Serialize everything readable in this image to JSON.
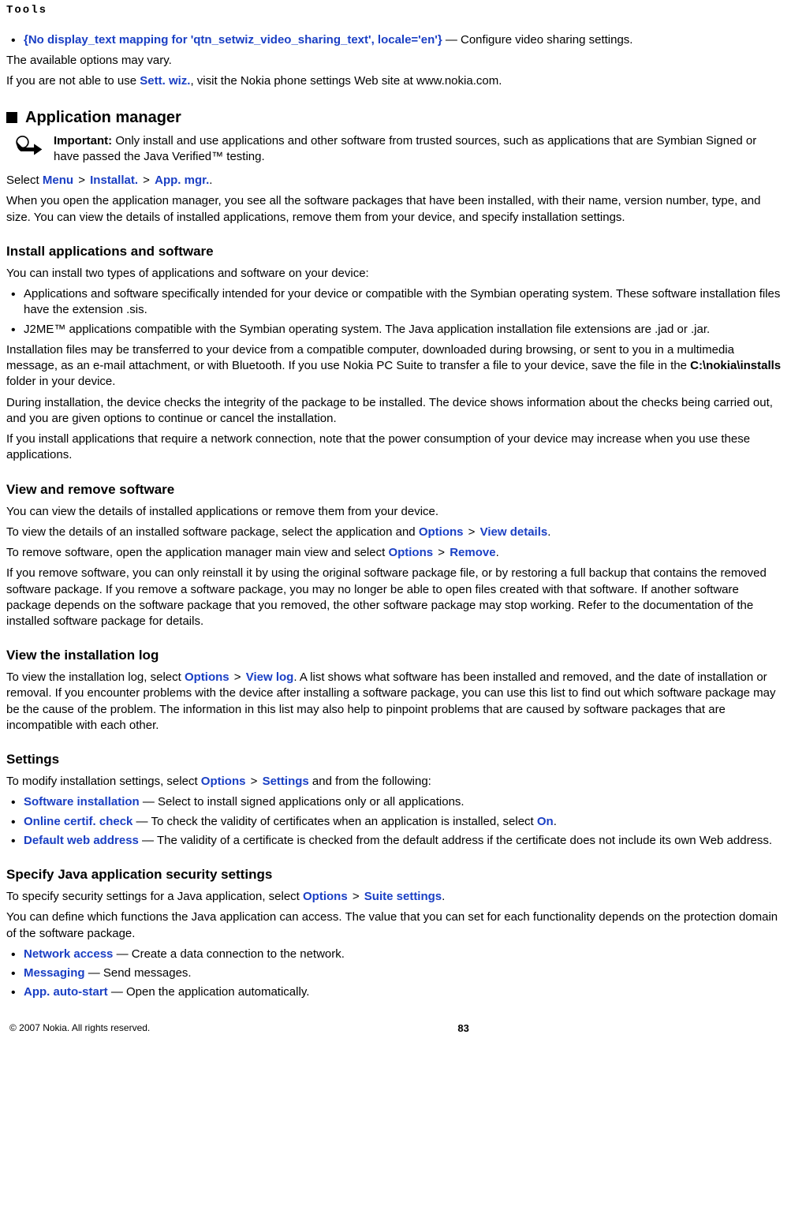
{
  "header": "Tools",
  "intro": {
    "bullet_link": "{No display_text mapping for 'qtn_setwiz_video_sharing_text', locale='en'}",
    "bullet_rest": " — Configure video sharing settings.",
    "p1": "The available options may vary.",
    "p2_a": "If you are not able to use ",
    "p2_link": "Sett. wiz.",
    "p2_b": ", visit the Nokia phone settings Web site at www.nokia.com."
  },
  "appmgr": {
    "heading": "Application manager",
    "important_label": "Important:  ",
    "important_text": "Only install and use applications and other software from trusted sources, such as applications that are Symbian Signed or have passed the Java Verified™ testing.",
    "select_a": "Select ",
    "menu": "Menu",
    "gt": " > ",
    "installat": "Installat.",
    "appmgr_link": "App. mgr.",
    "select_b": ".",
    "p1": "When you open the application manager, you see all the software packages that have been installed, with their name, version number, type, and size. You can view the details of installed applications, remove them from your device, and specify installation settings."
  },
  "install": {
    "heading": "Install applications and software",
    "p1": "You can install two types of applications and software on your device:",
    "b1": "Applications and software specifically intended for your device or compatible with the Symbian operating system. These software installation files have the extension .sis.",
    "b2": "J2ME™ applications compatible with the Symbian operating system. The Java application installation file extensions are .jad or .jar.",
    "p2a": "Installation files may be transferred to your device from a compatible computer, downloaded during browsing, or sent to you in a multimedia message, as an e-mail attachment, or with Bluetooth. If you use Nokia PC Suite to transfer a file to your device, save the file in the ",
    "path": "C:\\nokia\\installs",
    "p2b": " folder in your device.",
    "p3": "During installation, the device checks the integrity of the package to be installed. The device shows information about the checks being carried out, and you are given options to continue or cancel the installation.",
    "p4": "If you install applications that require a network connection, note that the power consumption of your device may increase when you use these applications."
  },
  "view_remove": {
    "heading": "View and remove software",
    "p1": "You can view the details of installed applications or remove them from your device.",
    "p2a": "To view the details of an installed software package, select the application and ",
    "options": "Options",
    "view_details": "View details",
    "p2b": ".",
    "p3a": "To remove software, open the application manager main view and select ",
    "remove": "Remove",
    "p3b": ".",
    "p4": "If you remove software, you can only reinstall it by using the original software package file, or by restoring a full backup that contains the removed software package. If you remove a software package, you may no longer be able to open files created with that software. If another software package depends on the software package that you removed, the other software package may stop working. Refer to the documentation of the installed software package for details."
  },
  "log": {
    "heading": "View the installation log",
    "p1a": "To view the installation log, select ",
    "view_log": "View log",
    "p1b": ". A list shows what software has been installed and removed, and the date of installation or removal. If you encounter problems with the device after installing a software package, you can use this list to find out which software package may be the cause of the problem. The information in this list may also help to pinpoint problems that are caused by software packages that are incompatible with each other."
  },
  "settings": {
    "heading": "Settings",
    "p1a": "To modify installation settings, select ",
    "settings_link": "Settings",
    "p1b": " and from the following:",
    "b1_link": "Software installation",
    "b1_rest": " — Select to install signed applications only or all applications.",
    "b2_link": "Online certif. check",
    "b2_rest_a": " — To check the validity of certificates when an application is installed, select ",
    "b2_on": "On",
    "b2_rest_b": ".",
    "b3_link": "Default web address",
    "b3_rest": " — The validity of a certificate is checked from the default address if the certificate does not include its own Web address."
  },
  "java": {
    "heading": "Specify Java application security settings",
    "p1a": "To specify security settings for a Java application, select ",
    "suite": "Suite settings",
    "p1b": ".",
    "p2": "You can define which functions the Java application can access. The value that you can set for each functionality depends on the protection domain of the software package.",
    "b1_link": "Network access",
    "b1_rest": " — Create a data connection to the network.",
    "b2_link": "Messaging",
    "b2_rest": " — Send messages.",
    "b3_link": "App. auto-start",
    "b3_rest": " — Open the application automatically."
  },
  "footer": {
    "copyright": "© 2007 Nokia. All rights reserved.",
    "page": "83"
  }
}
